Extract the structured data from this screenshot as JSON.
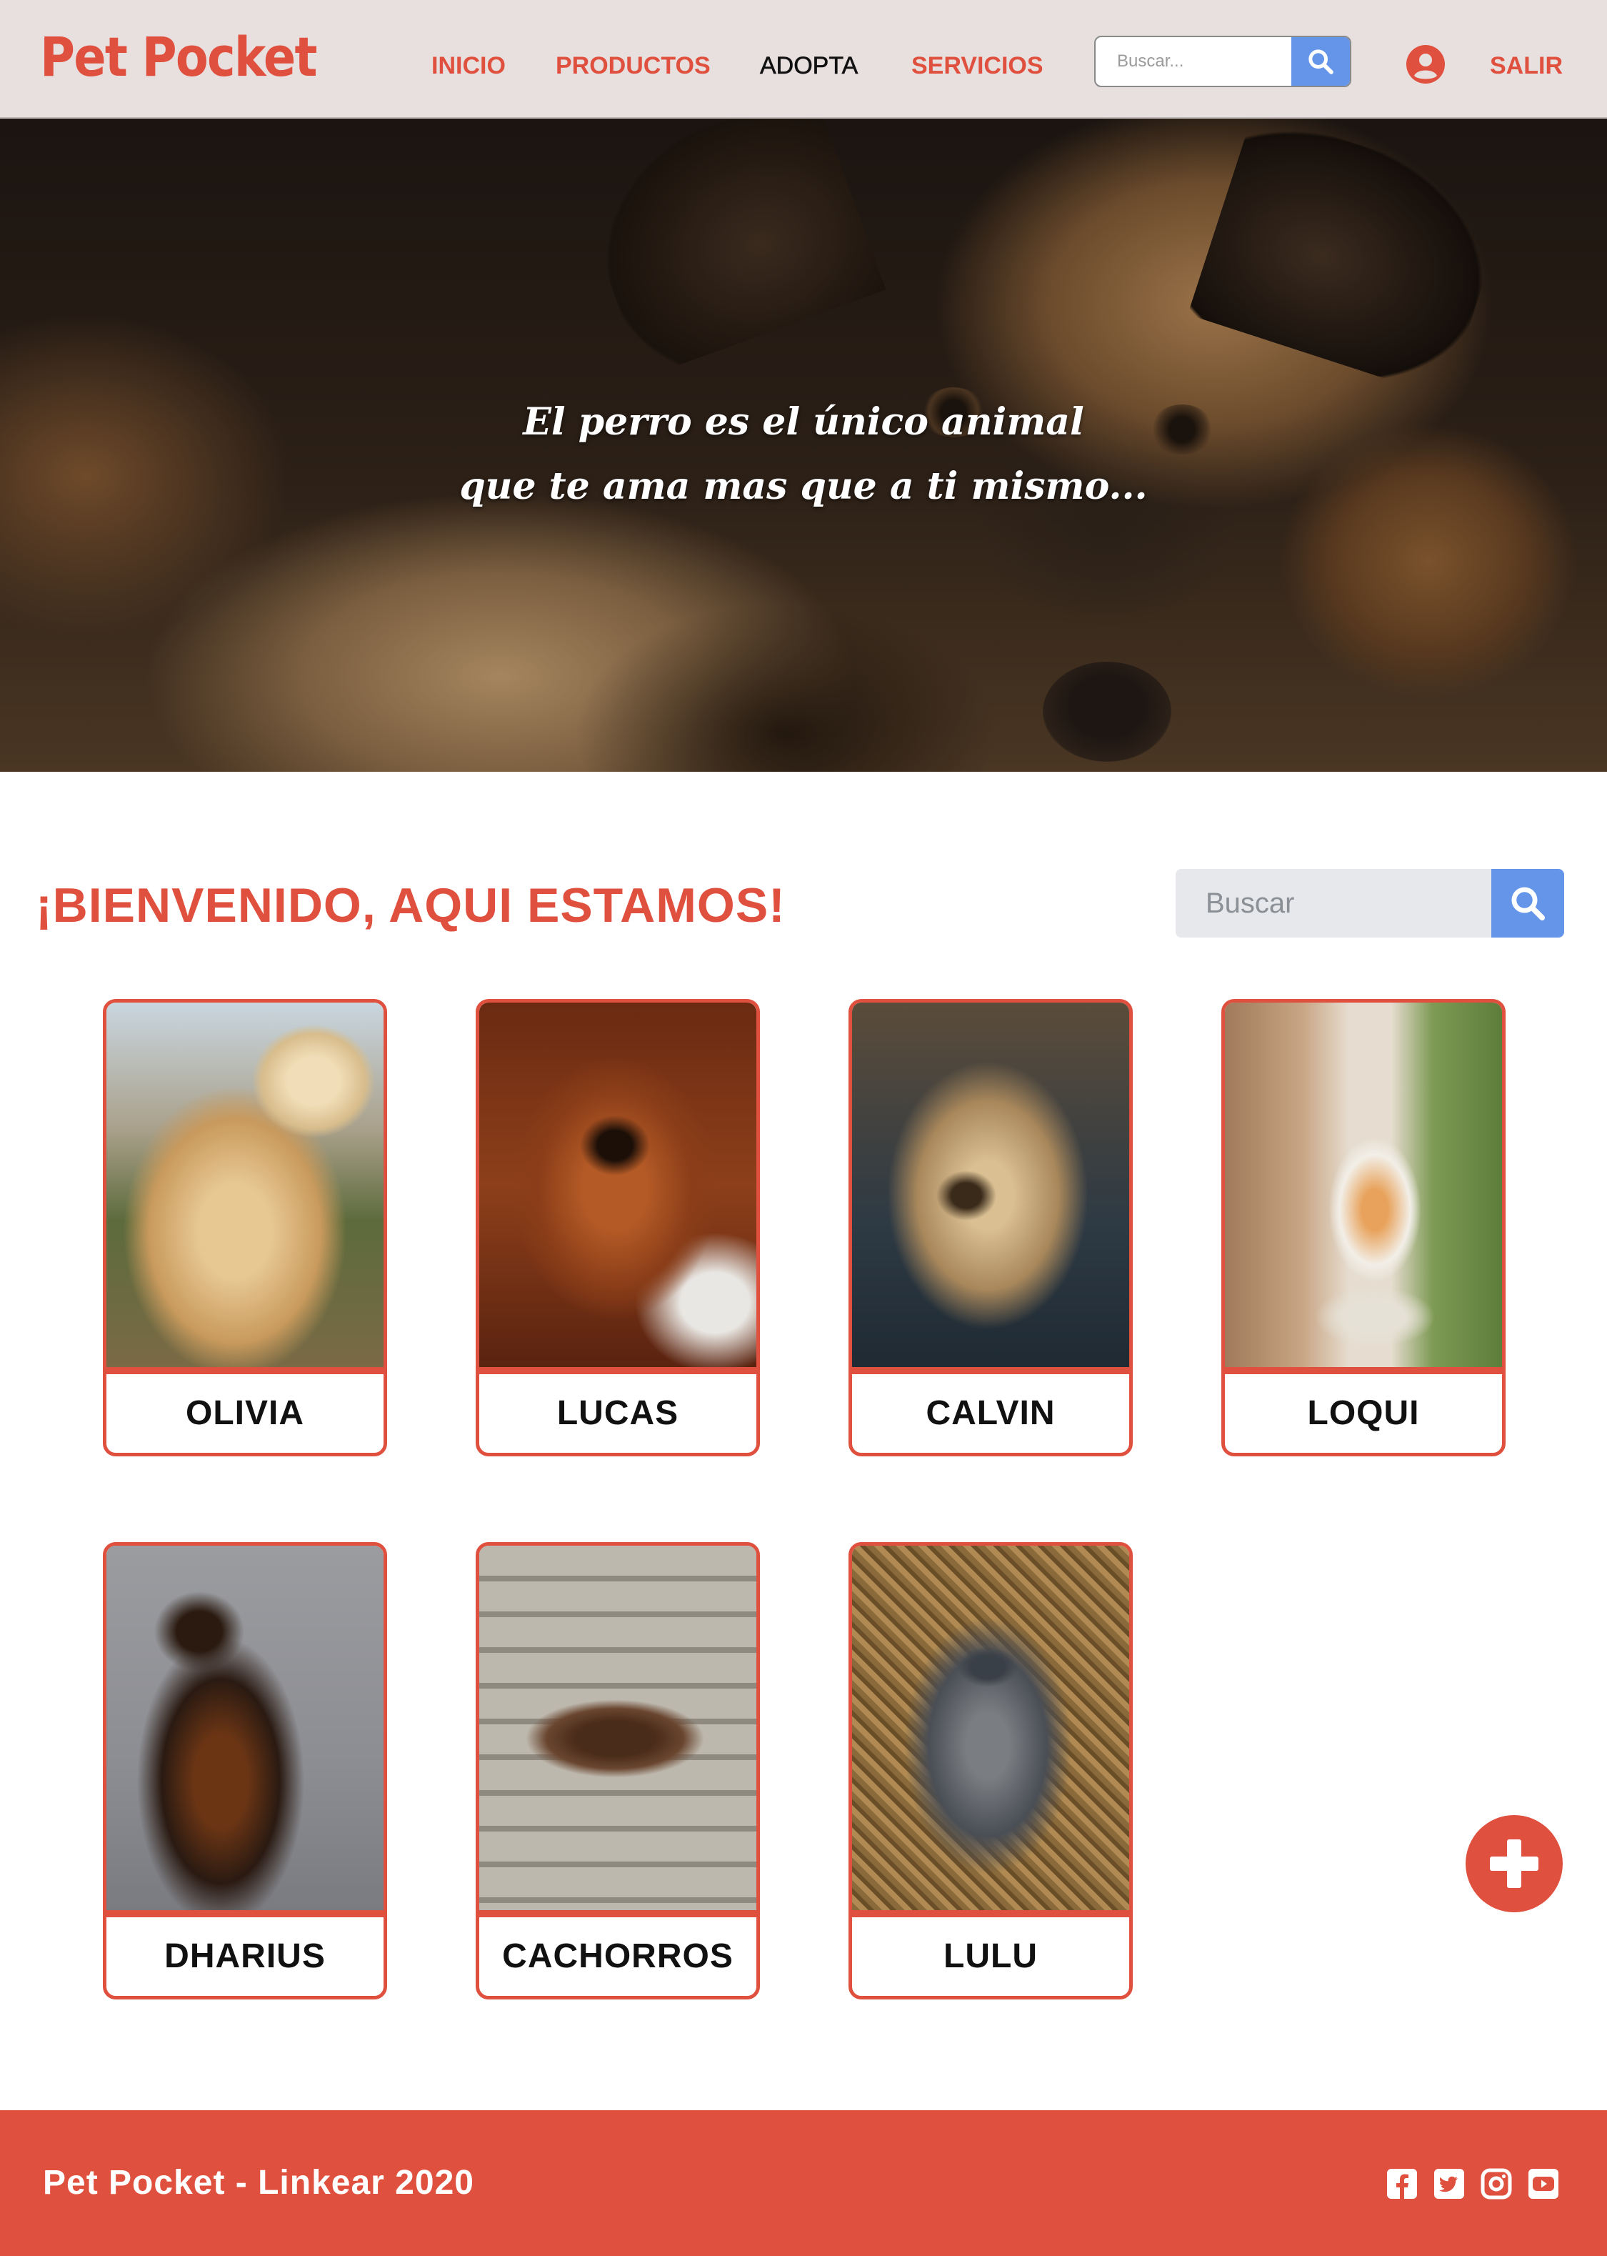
{
  "header": {
    "logo": "Pet Pocket",
    "nav": [
      {
        "label": "INICIO",
        "active": false
      },
      {
        "label": "PRODUCTOS",
        "active": false
      },
      {
        "label": "ADOPTA",
        "active": true
      },
      {
        "label": "SERVICIOS",
        "active": false
      }
    ],
    "search": {
      "placeholder": "Buscar...",
      "value": ""
    },
    "user_icon": "user-circle-icon",
    "logout_label": "SALIR"
  },
  "hero": {
    "quote_line1": "El perro es el único animal",
    "quote_line2": "que te ama mas que a ti mismo..."
  },
  "main": {
    "title": "¡BIENVENIDO, AQUI ESTAMOS!",
    "search": {
      "placeholder": "Buscar",
      "value": ""
    },
    "pets": [
      {
        "name": "OLIVIA"
      },
      {
        "name": "LUCAS"
      },
      {
        "name": "CALVIN"
      },
      {
        "name": "LOQUI"
      },
      {
        "name": "DHARIUS"
      },
      {
        "name": "CACHORROS"
      },
      {
        "name": "LULU"
      }
    ],
    "add_icon": "plus-icon"
  },
  "footer": {
    "text": "Pet Pocket - Linkear 2020",
    "social": [
      "facebook-icon",
      "twitter-icon",
      "instagram-icon",
      "youtube-icon"
    ]
  },
  "colors": {
    "accent": "#e0503e",
    "header_bg": "#e8dfdf",
    "search_button": "#6495e9",
    "search_field": "#e6e8ec"
  }
}
